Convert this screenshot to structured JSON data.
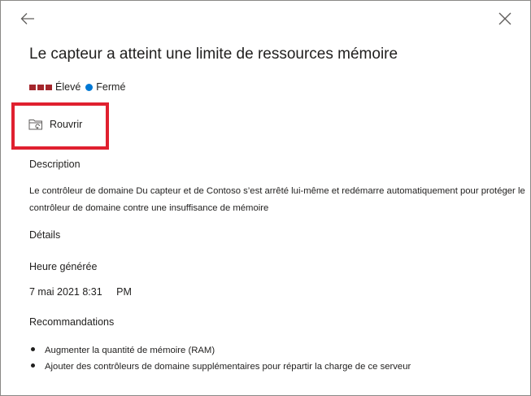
{
  "header": {
    "back_icon": "arrow-left-icon",
    "close_icon": "close-icon"
  },
  "alert": {
    "title": "Le capteur a atteint une limite de ressources mémoire",
    "severity": "Élevé",
    "severity_color": "#a4262c",
    "state": "Fermé",
    "state_color": "#0078d4"
  },
  "actions": {
    "reopen_label": "Rouvrir",
    "reopen_icon": "folder-reopen-icon",
    "highlight_color": "#e0202f"
  },
  "description": {
    "heading": "Description",
    "line1": "Le contrôleur de domaine Du capteur et de Contoso s’est arrêté lui-même et redémarre automatiquement pour protéger le",
    "line2": "contrôleur de domaine contre une insuffisance de mémoire"
  },
  "details": {
    "heading": "Détails",
    "time_label": "Heure générée",
    "time_value": "7 mai 2021 8:31",
    "time_suffix": "PM"
  },
  "recommendations": {
    "heading": "Recommandations",
    "items": [
      "Augmenter la quantité de mémoire (RAM)",
      "Ajouter des contrôleurs de domaine supplémentaires pour répartir la charge de ce serveur"
    ]
  }
}
